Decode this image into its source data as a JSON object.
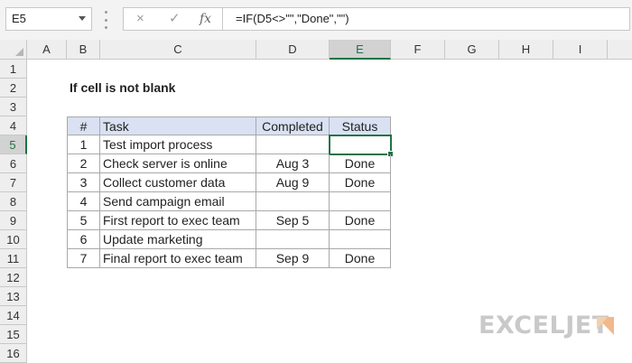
{
  "formula_bar": {
    "name_box": "E5",
    "cancel_icon": "×",
    "enter_icon": "✓",
    "fx_label": "fx",
    "formula": "=IF(D5<>\"\",\"Done\",\"\")"
  },
  "columns": [
    "A",
    "B",
    "C",
    "D",
    "E",
    "F",
    "G",
    "H",
    "I"
  ],
  "rows": [
    "1",
    "2",
    "3",
    "4",
    "5",
    "6",
    "7",
    "8",
    "9",
    "10",
    "11",
    "12",
    "13",
    "14",
    "15",
    "16"
  ],
  "selected": {
    "column": "E",
    "row": "5"
  },
  "sheet": {
    "title": "If cell is not blank",
    "headers": {
      "num": "#",
      "task": "Task",
      "completed": "Completed",
      "status": "Status"
    },
    "tasks": [
      {
        "num": "1",
        "task": "Test import process",
        "completed": "",
        "status": ""
      },
      {
        "num": "2",
        "task": "Check server is online",
        "completed": "Aug 3",
        "status": "Done"
      },
      {
        "num": "3",
        "task": "Collect customer data",
        "completed": "Aug 9",
        "status": "Done"
      },
      {
        "num": "4",
        "task": "Send campaign email",
        "completed": "",
        "status": ""
      },
      {
        "num": "5",
        "task": "First report to exec team",
        "completed": "Sep 5",
        "status": "Done"
      },
      {
        "num": "6",
        "task": "Update marketing",
        "completed": "",
        "status": ""
      },
      {
        "num": "7",
        "task": "Final report to exec team",
        "completed": "Sep 9",
        "status": "Done"
      }
    ]
  },
  "logo": {
    "text": "EXCELJET",
    "colors": {
      "text": "#c9c9c9",
      "mark": "#f0b98a"
    }
  },
  "colors": {
    "header_fill": "#d9e1f2",
    "selection": "#217346"
  }
}
